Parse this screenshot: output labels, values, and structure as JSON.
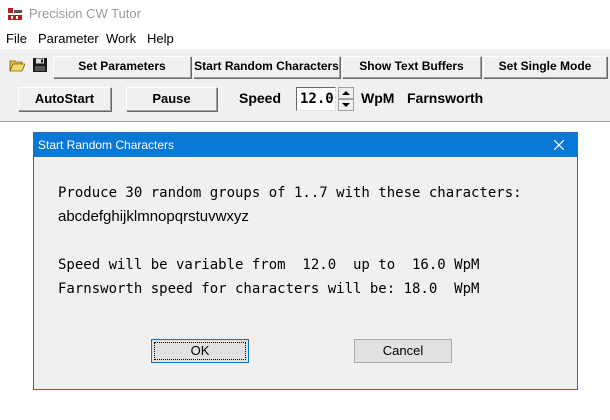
{
  "window": {
    "title": "Precision CW Tutor"
  },
  "menu": [
    "File",
    "Parameter",
    "Work",
    "Help"
  ],
  "toolbar": {
    "icons": [
      "open-folder-icon",
      "save-disk-icon"
    ],
    "buttons": [
      "Set Parameters",
      "Start Random Characters",
      "Show Text Buffers",
      "Set Single Mode"
    ]
  },
  "controls": {
    "autostart_label": "AutoStart",
    "pause_label": "Pause",
    "speed_label": "Speed",
    "speed_value": "12.0",
    "unit_label": "WpM",
    "farnsworth_label": "Farnsworth"
  },
  "dialog": {
    "title": "Start Random Characters",
    "line1": "Produce 30 random groups of 1..7 with these characters:",
    "characters": "abcdefghijklmnopqrstuvwxyz",
    "line3": "Speed will be variable from  12.0  up to  16.0 WpM",
    "line4": "Farnsworth speed for characters will be: 18.0  WpM",
    "ok_label": "OK",
    "cancel_label": "Cancel"
  },
  "colors": {
    "accent": "#0a78d7",
    "window_bg": "#f0f0f0",
    "icon_red": "#c0392b"
  }
}
